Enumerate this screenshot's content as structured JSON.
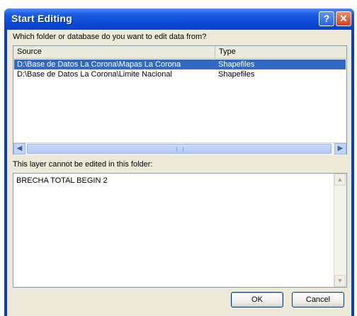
{
  "dialog": {
    "title": "Start Editing",
    "help_glyph": "?",
    "close_glyph": "✕"
  },
  "question": "Which folder or database do you want to edit data from?",
  "list": {
    "columns": [
      "Source",
      "Type"
    ],
    "rows": [
      {
        "source": "D:\\Base de Datos La Corona\\Mapas La Corona",
        "type": "Shapefiles",
        "selected": true
      },
      {
        "source": "D:\\Base de Datos La Corona\\Limite Nacional",
        "type": "Shapefiles",
        "selected": false
      }
    ]
  },
  "info_label": "This layer cannot be edited in this folder:",
  "details_text": "BRECHA TOTAL BEGIN 2",
  "buttons": {
    "ok": "OK",
    "cancel": "Cancel"
  },
  "icons": {
    "scroll_left": "arrow-left-icon",
    "scroll_right": "arrow-right-icon",
    "scroll_up": "arrow-up-icon",
    "scroll_down": "arrow-down-icon"
  },
  "colors": {
    "title_bar": "#0a48d6",
    "selection": "#316ac5",
    "close_button": "#d5421c"
  }
}
